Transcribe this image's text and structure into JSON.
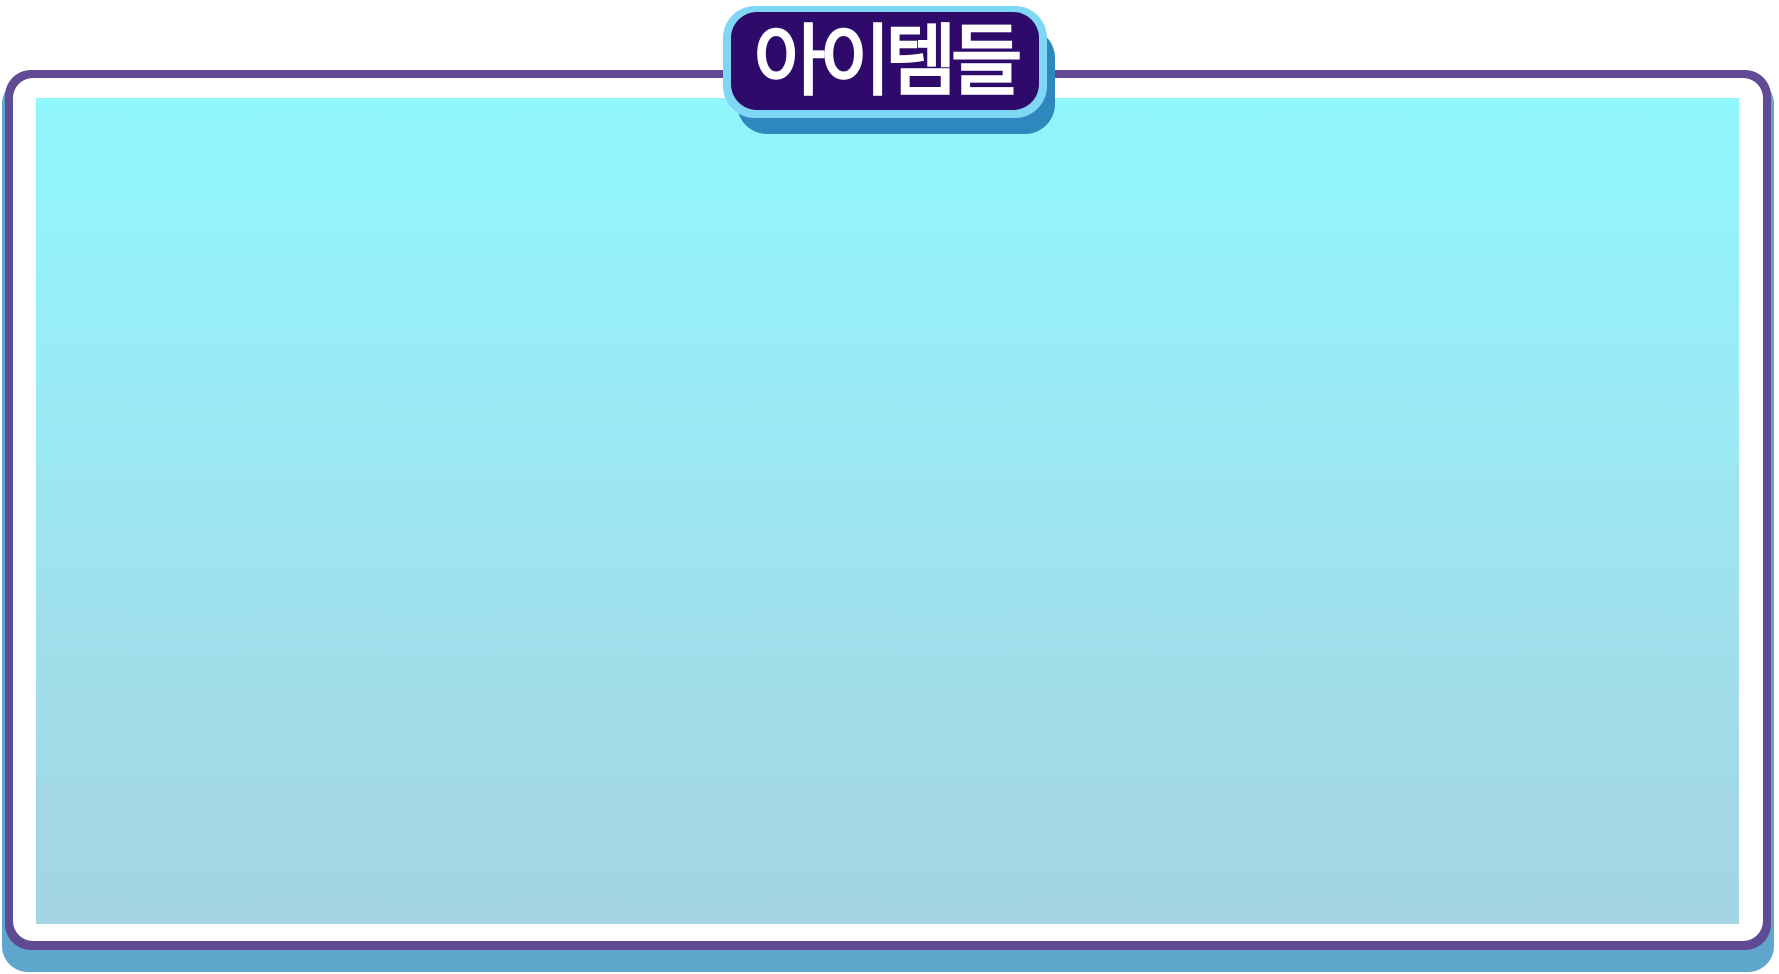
{
  "panel": {
    "title": "아이템들",
    "colors": {
      "border": "#604a93",
      "rim": "#ffffff",
      "shadow": "#5ea6cc",
      "content_top": "#8ff7fd",
      "content_bottom": "#a3d5e2",
      "badge_fill": "#2e0a6b",
      "badge_outline": "#7fd6f5",
      "badge_shadow": "#2f88bd"
    }
  }
}
